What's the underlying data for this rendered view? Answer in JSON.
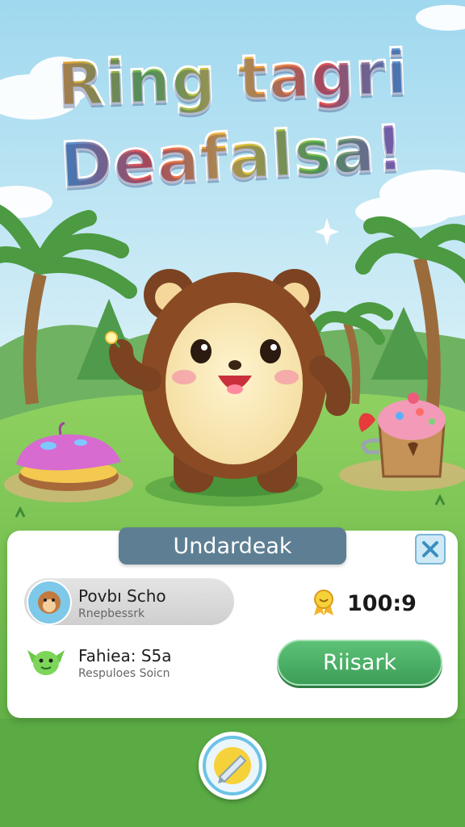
{
  "game": {
    "title_line1": "Ring tagri",
    "title_line2": "Deafalsa!",
    "title_colors": [
      "#f2a03a",
      "#66bb4a",
      "#f2c23a",
      "#e94f4f",
      "#4a9de0",
      "#a35fd6"
    ]
  },
  "panel": {
    "header": "Undardeak",
    "close_icon": "close-x-icon",
    "player1": {
      "name": "Povbı Scho",
      "subtitle": "Rnepbessrk"
    },
    "score_value": "100:9",
    "score_icon": "medal-icon",
    "player2": {
      "name": "Fahiea: S5a",
      "subtitle": "Respuloes Soicn"
    },
    "action_button": "Riisark"
  },
  "bottom_button_icon": "pencil-icon",
  "colors": {
    "sky": "#bfe7f5",
    "grass": "#7cc65a",
    "panel_header": "#5e7f93",
    "action_green": "#4caf63"
  }
}
